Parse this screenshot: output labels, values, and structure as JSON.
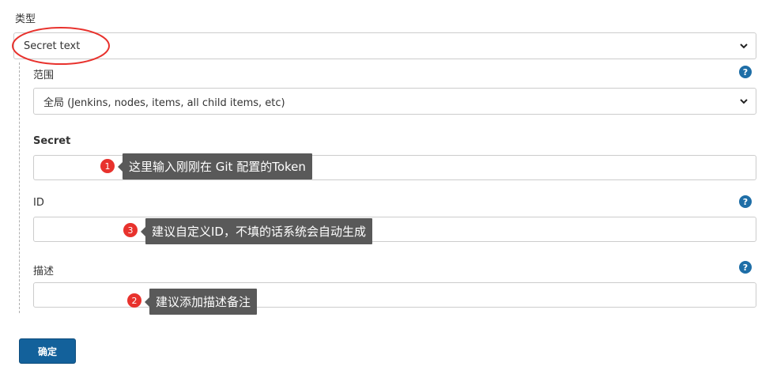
{
  "type_field": {
    "label": "类型",
    "selected": "Secret text"
  },
  "scope_field": {
    "label": "范围",
    "selected": "全局 (Jenkins, nodes, items, all child items, etc)"
  },
  "secret_field": {
    "label": "Secret",
    "value": ""
  },
  "id_field": {
    "label": "ID",
    "value": ""
  },
  "description_field": {
    "label": "描述",
    "value": ""
  },
  "help_icon": "?",
  "annotations": [
    {
      "number": "1",
      "text": "这里输入刚刚在 Git 配置的Token"
    },
    {
      "number": "3",
      "text": "建议自定义ID，不填的话系统会自动生成"
    },
    {
      "number": "2",
      "text": "建议添加描述备注"
    }
  ],
  "ok_button": {
    "label": "确定"
  },
  "colors": {
    "primary": "#13619b",
    "help": "#1e6ea7",
    "highlight": "#e8322d",
    "tooltip": "#595959"
  }
}
